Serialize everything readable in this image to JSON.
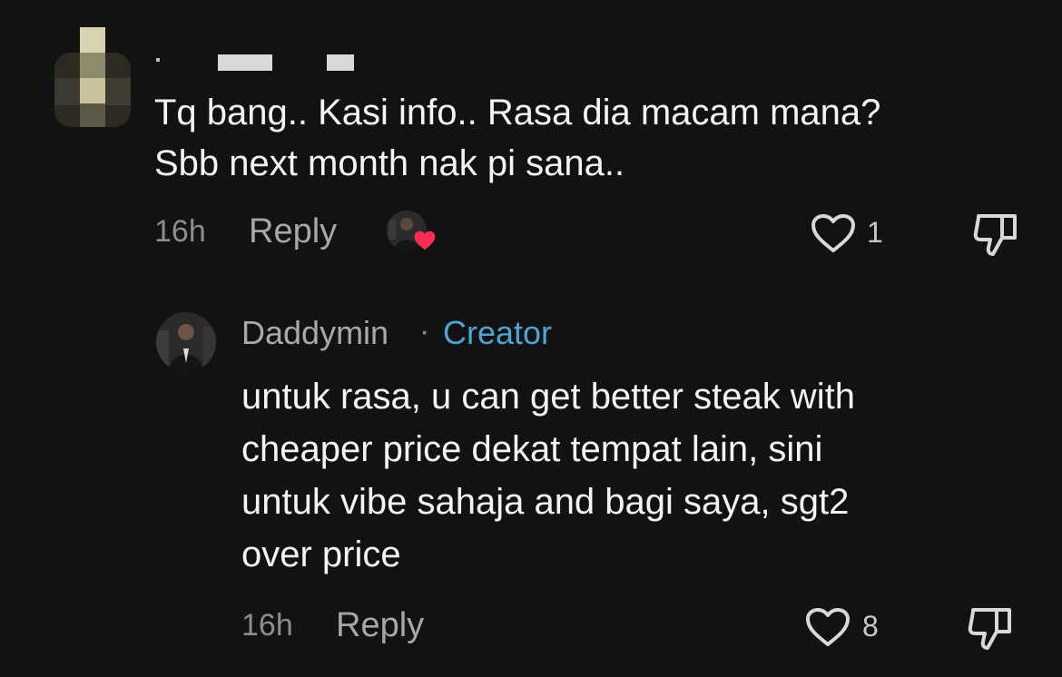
{
  "top_comment": {
    "text": "Tq bang.. Kasi info.. Rasa dia macam mana?\nSbb next month nak pi sana..",
    "time": "16h",
    "reply_label": "Reply",
    "likes": "1",
    "liked_by_creator": true
  },
  "reply_comment": {
    "username": "Daddymin",
    "separator": "·",
    "badge": "Creator",
    "text": "untuk rasa, u can get better steak with\ncheaper price dekat tempat lain, sini\nuntuk vibe sahaja and bagi saya, sgt2\nover price",
    "time": "16h",
    "reply_label": "Reply",
    "likes": "8"
  },
  "colors": {
    "background": "#121212",
    "text": "#f4f4f4",
    "muted": "#8d8d8d",
    "creator": "#4aa6d6",
    "heart_red": "#fe2c55"
  },
  "icons": {
    "like": "heart-outline-icon",
    "dislike": "thumbs-down-icon",
    "liked_by": "red-heart-icon"
  }
}
